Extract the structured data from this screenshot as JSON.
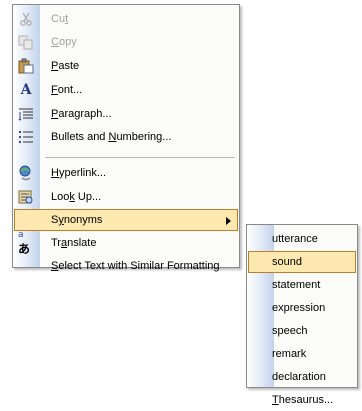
{
  "context_menu": {
    "items": [
      {
        "pre": "Cu",
        "acc": "t",
        "post": "",
        "disabled": true,
        "icon": "scissors-icon"
      },
      {
        "pre": "",
        "acc": "C",
        "post": "opy",
        "disabled": true,
        "icon": "copy-icon"
      },
      {
        "pre": "",
        "acc": "P",
        "post": "aste",
        "disabled": false,
        "icon": "paste-icon"
      },
      {
        "pre": "",
        "acc": "F",
        "post": "ont...",
        "disabled": false,
        "icon": "font-icon"
      },
      {
        "pre": "",
        "acc": "P",
        "post": "aragraph...",
        "disabled": false,
        "icon": "paragraph-icon"
      },
      {
        "pre": "Bullets and ",
        "acc": "N",
        "post": "umbering...",
        "disabled": false,
        "icon": "bullets-icon"
      },
      {
        "pre": "",
        "acc": "H",
        "post": "yperlink...",
        "disabled": false,
        "icon": "hyperlink-icon"
      },
      {
        "pre": "Loo",
        "acc": "k",
        "post": " Up...",
        "disabled": false,
        "icon": "research-icon"
      },
      {
        "pre": "S",
        "acc": "y",
        "post": "nonyms",
        "disabled": false,
        "highlighted": true
      },
      {
        "pre": "Tr",
        "acc": "a",
        "post": "nslate",
        "disabled": false,
        "icon": "translate-icon"
      },
      {
        "pre": "",
        "acc": "S",
        "post": "elect Text with Similar Formatting",
        "disabled": false
      }
    ]
  },
  "synonyms_menu": {
    "items": [
      {
        "pre": "utterance",
        "acc": "",
        "post": ""
      },
      {
        "pre": "sound",
        "acc": "",
        "post": "",
        "highlighted": true
      },
      {
        "pre": "statement",
        "acc": "",
        "post": ""
      },
      {
        "pre": "expression",
        "acc": "",
        "post": ""
      },
      {
        "pre": "speech",
        "acc": "",
        "post": ""
      },
      {
        "pre": "remark",
        "acc": "",
        "post": ""
      },
      {
        "pre": "declaration",
        "acc": "",
        "post": ""
      },
      {
        "pre": "",
        "acc": "T",
        "post": "hesaurus..."
      }
    ]
  }
}
